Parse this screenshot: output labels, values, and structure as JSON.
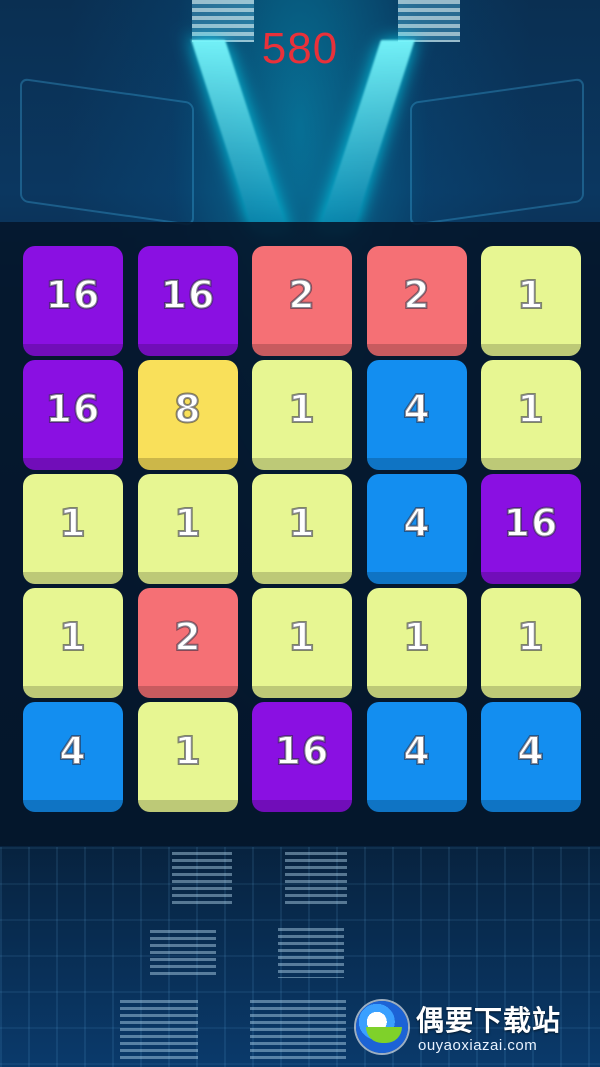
{
  "score": "580",
  "colors": {
    "score": "#e8313a",
    "tile_1": "#e7f692",
    "tile_2": "#f57075",
    "tile_4": "#138ef0",
    "tile_8": "#f9e05a",
    "tile_16": "#8a10e2"
  },
  "board": {
    "rows": [
      [
        "16",
        "16",
        "2",
        "2",
        "1"
      ],
      [
        "16",
        "8",
        "1",
        "4",
        "1"
      ],
      [
        "1",
        "1",
        "1",
        "4",
        "16"
      ],
      [
        "1",
        "2",
        "1",
        "1",
        "1"
      ],
      [
        "4",
        "1",
        "16",
        "4",
        "4"
      ]
    ]
  },
  "watermark": {
    "title": "偶要下载站",
    "url": "ouyaoxiazai.com",
    "logo_icon": "ouyao-logo-icon"
  }
}
